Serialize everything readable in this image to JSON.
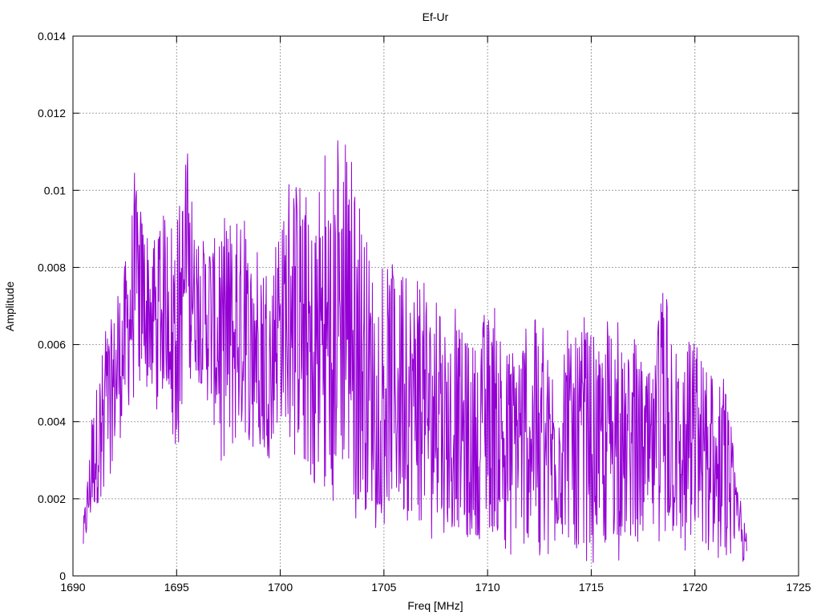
{
  "chart_data": {
    "type": "line",
    "title": "Ef-Ur",
    "xlabel": "Freq [MHz]",
    "ylabel": "Amplitude",
    "xlim": [
      1690,
      1725
    ],
    "ylim": [
      0,
      0.014
    ],
    "x_ticks": [
      "1690",
      "1695",
      "1700",
      "1705",
      "1710",
      "1715",
      "1720",
      "1725"
    ],
    "y_ticks": [
      "0",
      "0.002",
      "0.004",
      "0.006",
      "0.008",
      "0.01",
      "0.012",
      "0.014"
    ],
    "grid": true,
    "legend": "none",
    "series": [
      {
        "color": "#9400d3",
        "x_range": [
          1690.5,
          1722.5
        ],
        "envelope_x": [
          1690.5,
          1691.0,
          1691.5,
          1692.0,
          1692.5,
          1693.0,
          1693.5,
          1694.0,
          1694.5,
          1695.0,
          1695.5,
          1696.0,
          1696.5,
          1697.0,
          1697.5,
          1698.0,
          1698.5,
          1699.0,
          1699.5,
          1700.0,
          1700.5,
          1701.0,
          1701.5,
          1702.0,
          1702.5,
          1703.0,
          1703.5,
          1704.0,
          1704.5,
          1705.0,
          1705.5,
          1706.0,
          1706.5,
          1707.0,
          1707.5,
          1708.0,
          1708.5,
          1709.0,
          1709.5,
          1710.0,
          1710.5,
          1711.0,
          1711.5,
          1712.0,
          1712.5,
          1713.0,
          1713.5,
          1714.0,
          1714.5,
          1715.0,
          1715.5,
          1716.0,
          1716.5,
          1717.0,
          1717.5,
          1718.0,
          1718.5,
          1719.0,
          1719.5,
          1720.0,
          1720.5,
          1721.0,
          1721.5,
          1722.0,
          1722.5
        ],
        "envelope_max": [
          0.0015,
          0.0048,
          0.0065,
          0.0072,
          0.0085,
          0.0106,
          0.0096,
          0.009,
          0.0098,
          0.01,
          0.0112,
          0.0085,
          0.0096,
          0.009,
          0.0096,
          0.0098,
          0.009,
          0.0092,
          0.0085,
          0.009,
          0.0117,
          0.01,
          0.0098,
          0.0115,
          0.0108,
          0.0123,
          0.0108,
          0.01,
          0.0085,
          0.0088,
          0.0083,
          0.0078,
          0.0082,
          0.0078,
          0.0071,
          0.0068,
          0.007,
          0.0066,
          0.0065,
          0.007,
          0.0075,
          0.0062,
          0.007,
          0.007,
          0.0067,
          0.0061,
          0.0062,
          0.0065,
          0.0068,
          0.007,
          0.006,
          0.0075,
          0.006,
          0.0062,
          0.0058,
          0.0056,
          0.008,
          0.0058,
          0.0062,
          0.0068,
          0.0058,
          0.0048,
          0.0052,
          0.0025,
          0.0012
        ],
        "envelope_min": [
          0.0005,
          0.0013,
          0.002,
          0.0028,
          0.0035,
          0.0045,
          0.0048,
          0.0042,
          0.0046,
          0.003,
          0.0045,
          0.005,
          0.004,
          0.003,
          0.0022,
          0.003,
          0.0032,
          0.0032,
          0.003,
          0.0035,
          0.0035,
          0.0025,
          0.002,
          0.0015,
          0.0018,
          0.0018,
          0.0016,
          0.001,
          0.0012,
          0.0012,
          0.0012,
          0.0008,
          0.0012,
          0.0012,
          0.0008,
          0.0006,
          0.0008,
          0.0005,
          0.0006,
          0.0006,
          0.0005,
          0.0005,
          0.0005,
          0.0004,
          0.0004,
          0.0005,
          0.0005,
          0.0004,
          0.0005,
          0.0003,
          0.0003,
          0.0004,
          0.0004,
          0.0004,
          0.0004,
          0.0004,
          0.0004,
          0.0005,
          0.0004,
          0.0004,
          0.0004,
          0.0003,
          0.0004,
          0.0004,
          0.0001
        ]
      }
    ]
  }
}
